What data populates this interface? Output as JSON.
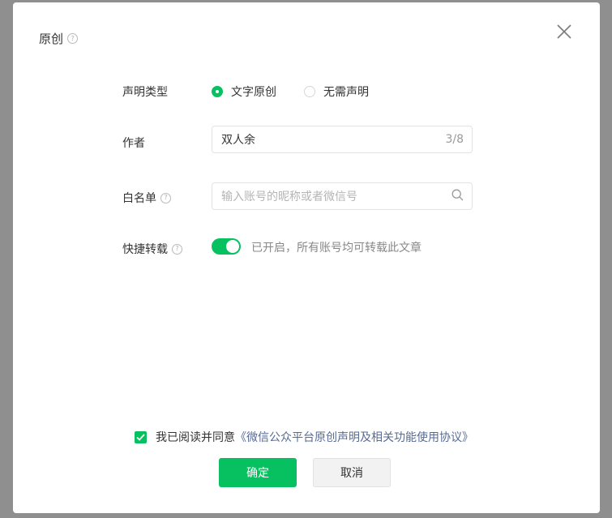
{
  "dialog": {
    "title": "原创",
    "help_glyph": "?"
  },
  "declaration_type": {
    "label": "声明类型",
    "options": [
      {
        "label": "文字原创",
        "selected": true
      },
      {
        "label": "无需声明",
        "selected": false
      }
    ]
  },
  "author": {
    "label": "作者",
    "value": "双人余",
    "counter": "3/8"
  },
  "whitelist": {
    "label": "白名单",
    "placeholder": "输入账号的昵称或者微信号"
  },
  "quick_repost": {
    "label": "快捷转载",
    "enabled": true,
    "status_text": "已开启，所有账号均可转载此文章"
  },
  "agreement": {
    "checked": true,
    "prefix": "我已阅读并同意",
    "link": "《微信公众平台原创声明及相关功能使用协议》"
  },
  "buttons": {
    "confirm": "确定",
    "cancel": "取消"
  },
  "colors": {
    "accent": "#07c160",
    "link": "#576b95"
  }
}
